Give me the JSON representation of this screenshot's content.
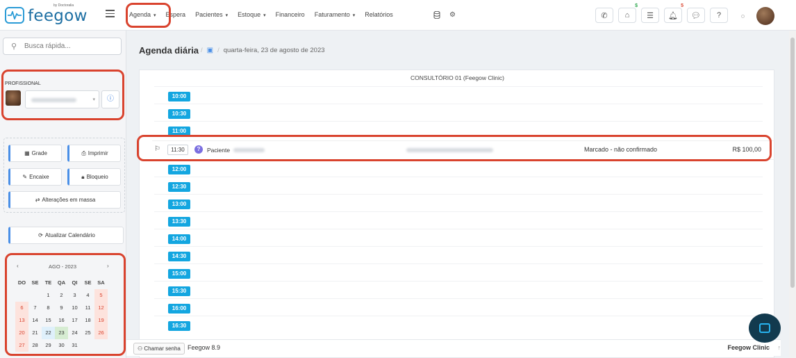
{
  "brand": {
    "name": "feegow",
    "by": "by Doctoralia"
  },
  "nav": [
    {
      "label": "Agenda",
      "caret": true
    },
    {
      "label": "Espera",
      "caret": false
    },
    {
      "label": "Pacientes",
      "caret": true
    },
    {
      "label": "Estoque",
      "caret": true
    },
    {
      "label": "Financeiro",
      "caret": false
    },
    {
      "label": "Faturamento",
      "caret": true
    },
    {
      "label": "Relatórios",
      "caret": false
    }
  ],
  "top_icons": {
    "inbox_badge": "$",
    "bell_badge": "5"
  },
  "search": {
    "placeholder": "Busca rápida..."
  },
  "professional": {
    "label": "PROFISSIONAL"
  },
  "sidebar_buttons": {
    "grade": "Grade",
    "imprimir": "Imprimir",
    "encaixe": "Encaixe",
    "bloqueio": "Bloqueio",
    "alteracoes": "Alterações em massa",
    "atualizar": "Atualizar Calendário"
  },
  "calendar": {
    "title": "AGO - 2023",
    "weekdays": [
      "DO",
      "SE",
      "TE",
      "QA",
      "QI",
      "SE",
      "SA"
    ],
    "days": [
      "",
      "",
      "1",
      "2",
      "3",
      "4",
      "5",
      "6",
      "7",
      "8",
      "9",
      "10",
      "11",
      "12",
      "13",
      "14",
      "15",
      "16",
      "17",
      "18",
      "19",
      "20",
      "21",
      "22",
      "23",
      "24",
      "25",
      "26",
      "27",
      "28",
      "29",
      "30",
      "31",
      "",
      ""
    ],
    "today": "22",
    "selected": "23"
  },
  "page": {
    "title": "Agenda diária",
    "date": "quarta-feira, 23 de agosto de 2023"
  },
  "schedule": {
    "column": "CONSULTÓRIO 01 (Feegow Clinic)",
    "slots_before": [
      "10:00",
      "10:30",
      "11:00"
    ],
    "slots_after": [
      "12:00",
      "12:30",
      "13:00",
      "13:30",
      "14:00",
      "14:30",
      "15:00",
      "15:30",
      "16:00",
      "16:30"
    ],
    "appointment": {
      "time": "11:30",
      "patient_label": "Paciente",
      "status": "Marcado - não confirmado",
      "price": "R$ 100,00"
    }
  },
  "footer": {
    "chamar": "Chamar senha",
    "version": "Feegow 8.9",
    "clinic": "Feegow Clinic"
  },
  "colors": {
    "accent": "#13a6e0",
    "highlight": "#d9432e",
    "weekend": "#d9432e"
  }
}
